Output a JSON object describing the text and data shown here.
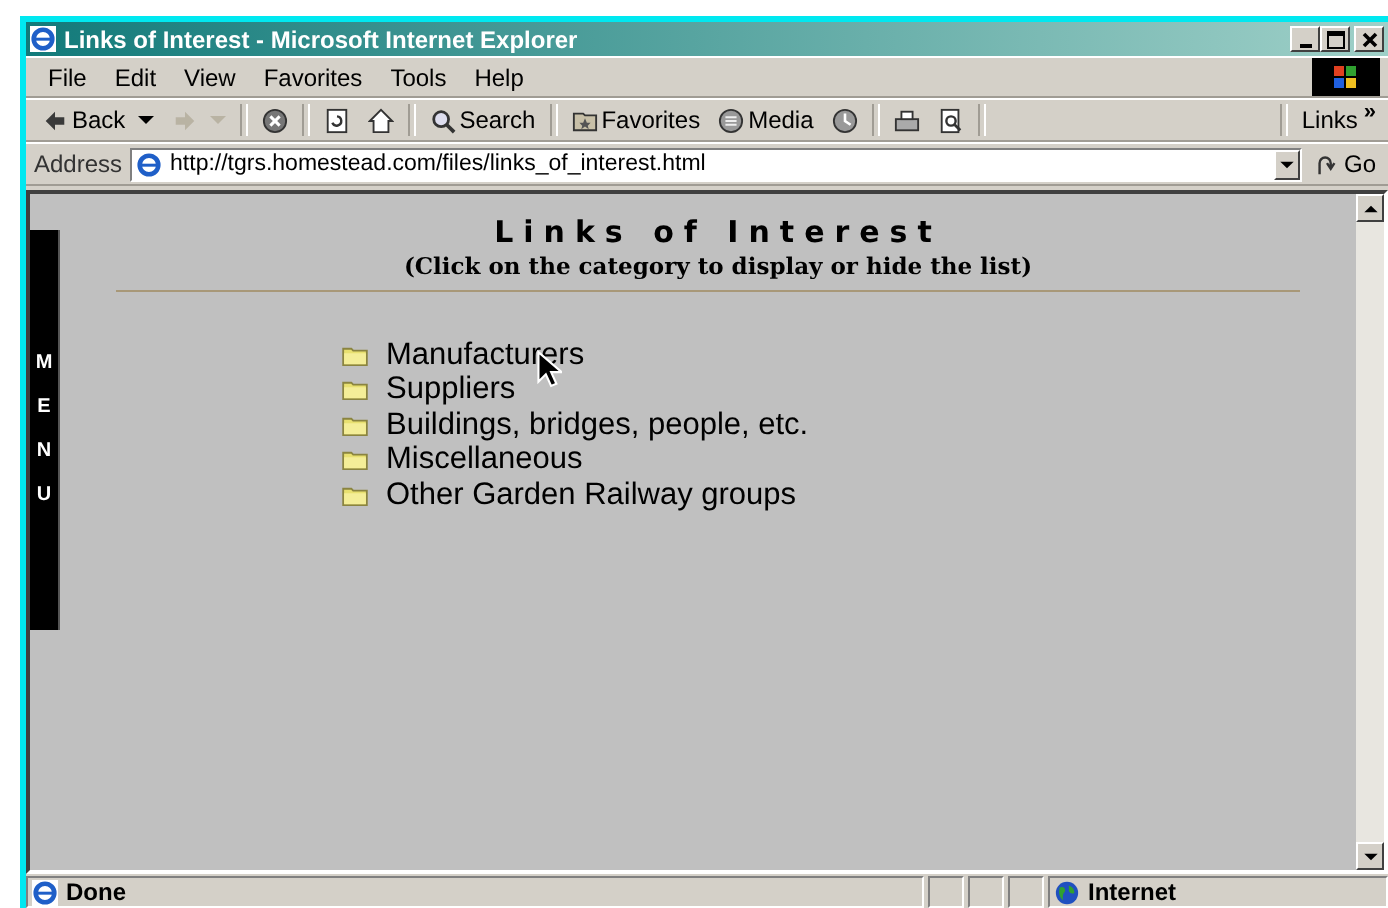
{
  "window": {
    "title": "Links of Interest - Microsoft Internet Explorer"
  },
  "menu": [
    "File",
    "Edit",
    "View",
    "Favorites",
    "Tools",
    "Help"
  ],
  "toolbar": [
    {
      "kind": "back",
      "label": "Back",
      "disabled": false
    },
    {
      "kind": "forward",
      "disabled": true
    },
    {
      "kind": "stop",
      "disabled": false
    },
    {
      "kind": "refresh",
      "disabled": false
    },
    {
      "kind": "home",
      "disabled": false
    },
    {
      "kind": "search",
      "label": "Search",
      "disabled": false
    },
    {
      "kind": "favorites",
      "label": "Favorites",
      "disabled": false
    },
    {
      "kind": "media",
      "label": "Media",
      "disabled": false
    },
    {
      "kind": "history",
      "disabled": false
    },
    {
      "kind": "print",
      "disabled": false
    },
    {
      "kind": "preview",
      "disabled": false
    }
  ],
  "links_button": "Links",
  "links_chevron": "»",
  "address": {
    "label": "Address",
    "value": "http://tgrs.homestead.com/files/links_of_interest.html",
    "go": "Go"
  },
  "page": {
    "side_menu": "MENU",
    "heading": "Links of Interest",
    "subheading": "(Click on the category to display or hide the list)",
    "categories": [
      "Manufacturers",
      "Suppliers",
      "Buildings, bridges, people, etc.",
      "Miscellaneous",
      "Other Garden Railway groups"
    ]
  },
  "status_bar": {
    "text": "Done",
    "zone": "Internet"
  }
}
